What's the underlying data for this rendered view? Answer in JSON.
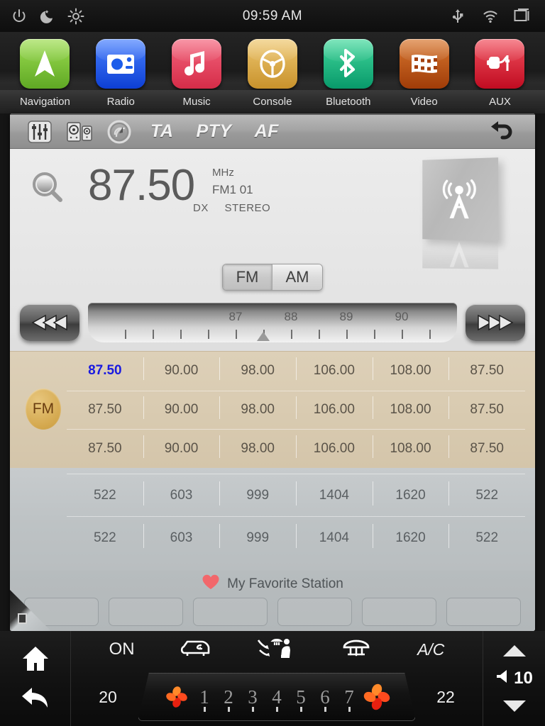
{
  "statusbar": {
    "time": "09:59 AM",
    "left_icons": [
      "power-icon",
      "night-mode-icon",
      "brightness-icon"
    ],
    "right_icons": [
      "usb-icon",
      "wifi-icon",
      "windows-icon"
    ]
  },
  "apps": [
    {
      "label": "Navigation",
      "icon": "navigation-arrow-icon",
      "color": "#7ac43a"
    },
    {
      "label": "Radio",
      "icon": "radio-icon",
      "color": "#1c5dea"
    },
    {
      "label": "Music",
      "icon": "music-note-icon",
      "color": "#e8445c"
    },
    {
      "label": "Console",
      "icon": "steering-wheel-icon",
      "color": "#dca53a"
    },
    {
      "label": "Bluetooth",
      "icon": "bluetooth-icon",
      "color": "#17b877"
    },
    {
      "label": "Video",
      "icon": "film-strip-icon",
      "color": "#c2581a"
    },
    {
      "label": "AUX",
      "icon": "aux-cable-icon",
      "color": "#e02030"
    }
  ],
  "toolbar": {
    "icons": [
      "equalizer-icon",
      "speakers-icon",
      "scan-radar-icon"
    ],
    "ta_label": "TA",
    "pty_label": "PTY",
    "af_label": "AF",
    "back_icon": "back-arrow-icon"
  },
  "tuner": {
    "search_icon": "magnifier-icon",
    "frequency": "87.50",
    "unit": "MHz",
    "band_preset": "FM1  01",
    "dx_label": "DX",
    "stereo_label": "STEREO",
    "tower_icon": "radio-tower-icon",
    "band_fm": "FM",
    "band_am": "AM",
    "selected_band": "FM",
    "scale_ticks": [
      "87",
      "88",
      "89",
      "90"
    ],
    "pointer_value": "87.50",
    "prev_icon": "seek-backward-icon",
    "next_icon": "seek-forward-icon"
  },
  "fm_presets": {
    "badge": "FM",
    "active_index": 0,
    "rows": [
      [
        "87.50",
        "90.00",
        "98.00",
        "106.00",
        "108.00",
        "87.50"
      ],
      [
        "87.50",
        "90.00",
        "98.00",
        "106.00",
        "108.00",
        "87.50"
      ],
      [
        "87.50",
        "90.00",
        "98.00",
        "106.00",
        "108.00",
        "87.50"
      ]
    ]
  },
  "am_presets": {
    "rows": [
      [
        "522",
        "603",
        "999",
        "1404",
        "1620",
        "522"
      ],
      [
        "522",
        "603",
        "999",
        "1404",
        "1620",
        "522"
      ]
    ]
  },
  "favorites": {
    "heart_icon": "heart-icon",
    "title": "My Favorite Station",
    "slots": [
      "",
      "",
      "",
      "",
      "",
      ""
    ]
  },
  "climate": {
    "home_icon": "home-icon",
    "back_icon": "back-arrow-icon",
    "on_label": "ON",
    "recirculate_icon": "car-recirculate-icon",
    "airflow_seat_icon": "airflow-seat-icon",
    "rear-defrost_icon": "rear-defrost-icon",
    "ac_label": "A/C",
    "temp_left": "20",
    "temp_right": "22",
    "fan_icon_left": "fan-icon",
    "fan_icon_right": "fan-icon",
    "fan_levels": [
      "1",
      "2",
      "3",
      "4",
      "5",
      "6",
      "7"
    ],
    "volume": "10",
    "volume_up_icon": "triangle-up-icon",
    "volume_down_icon": "triangle-down-icon",
    "speaker_icon": "speaker-icon"
  }
}
